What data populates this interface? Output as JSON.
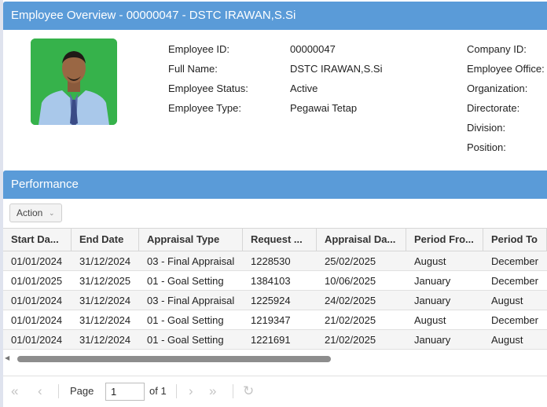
{
  "header": {
    "title": "Employee Overview - 00000047 - DSTC IRAWAN,S.Si"
  },
  "profile": {
    "fields": [
      {
        "label": "Employee ID:",
        "value": "00000047"
      },
      {
        "label": "Full Name:",
        "value": "DSTC IRAWAN,S.Si"
      },
      {
        "label": "Employee Status:",
        "value": "Active"
      },
      {
        "label": "Employee Type:",
        "value": "Pegawai Tetap"
      }
    ],
    "fields_right": [
      {
        "label": "Company ID:"
      },
      {
        "label": "Employee Office:"
      },
      {
        "label": "Organization:"
      },
      {
        "label": "Directorate:"
      },
      {
        "label": "Division:"
      },
      {
        "label": "Position:"
      }
    ]
  },
  "performance": {
    "title": "Performance",
    "action_label": "Action",
    "columns": [
      "Start Da...",
      "End Date",
      "Appraisal Type",
      "Request ...",
      "Appraisal Da...",
      "Period Fro...",
      "Period To"
    ],
    "rows": [
      [
        "01/01/2024",
        "31/12/2024",
        "03 - Final Appraisal",
        "1228530",
        "25/02/2025",
        "August",
        "December"
      ],
      [
        "01/01/2025",
        "31/12/2025",
        "01 - Goal Setting",
        "1384103",
        "10/06/2025",
        "January",
        "December"
      ],
      [
        "01/01/2024",
        "31/12/2024",
        "03 - Final Appraisal",
        "1225924",
        "24/02/2025",
        "January",
        "August"
      ],
      [
        "01/01/2024",
        "31/12/2024",
        "01 - Goal Setting",
        "1219347",
        "21/02/2025",
        "August",
        "December"
      ],
      [
        "01/01/2024",
        "31/12/2024",
        "01 - Goal Setting",
        "1221691",
        "21/02/2025",
        "January",
        "August"
      ]
    ]
  },
  "pager": {
    "page_label": "Page",
    "page_value": "1",
    "of_label": "of 1"
  },
  "icons": {
    "first": "first-page-icon",
    "prev": "prev-page-icon",
    "next": "next-page-icon",
    "last": "last-page-icon",
    "refresh": "refresh-icon"
  }
}
